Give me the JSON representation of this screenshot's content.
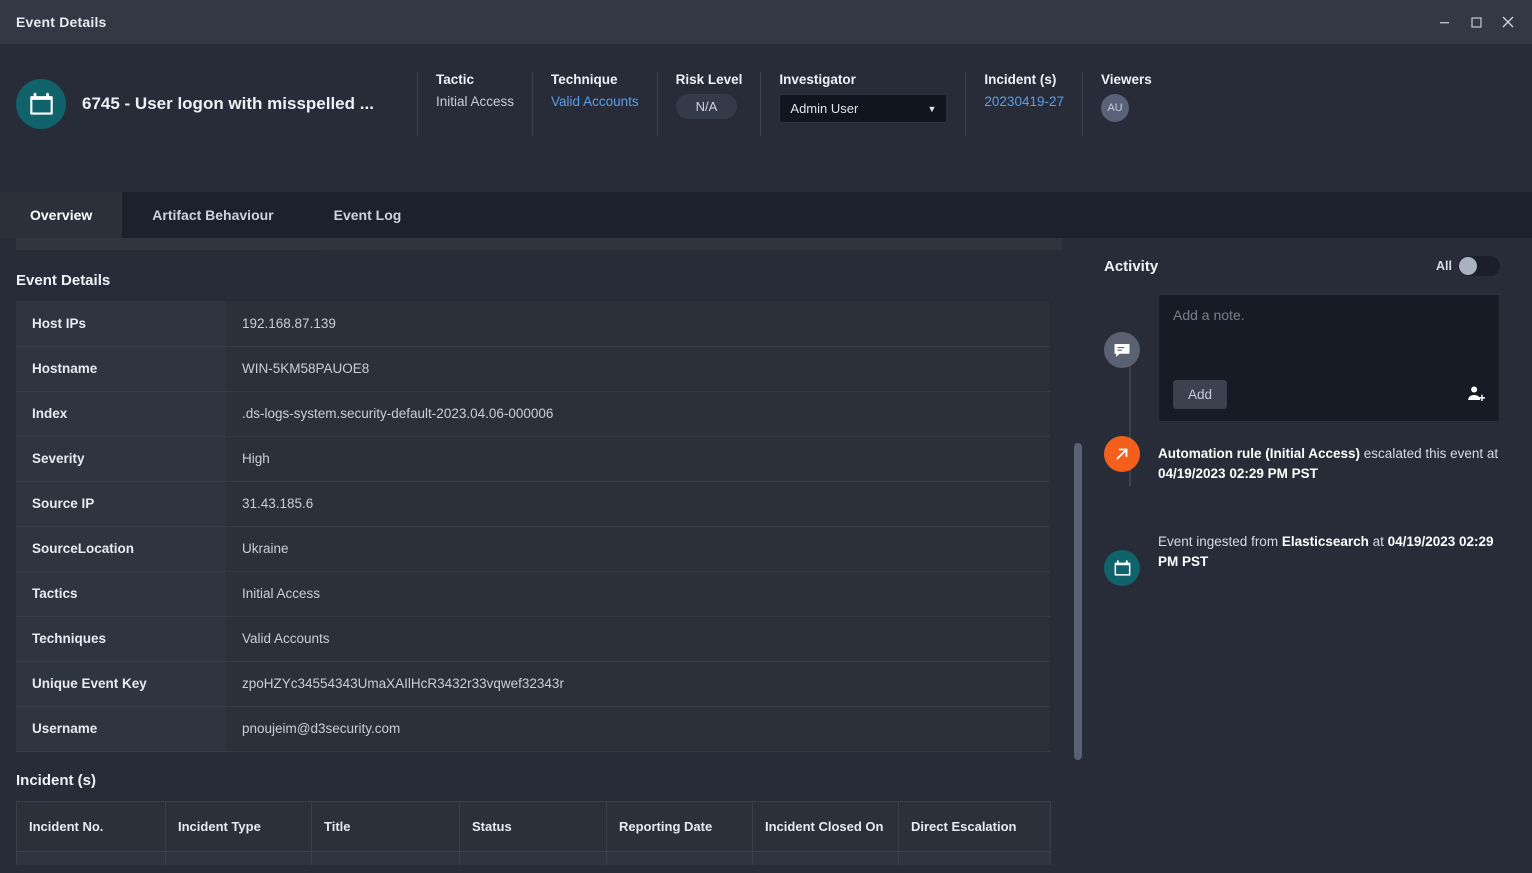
{
  "window": {
    "title": "Event Details",
    "controls": [
      {
        "name": "minimize",
        "glyph": "minimize-icon"
      },
      {
        "name": "maximize",
        "glyph": "maximize-icon"
      },
      {
        "name": "close",
        "glyph": "close-icon"
      }
    ]
  },
  "header": {
    "event_icon": "calendar-alert-icon",
    "event_title": "6745 - User logon with misspelled ...",
    "fields": [
      {
        "label": "Tactic",
        "value": "Initial Access"
      },
      {
        "label": "Technique",
        "value": "Valid Accounts"
      },
      {
        "label": "Risk Level",
        "value": "N/A"
      },
      {
        "label": "Investigator",
        "value": "Admin User"
      },
      {
        "label": "Incident (s)",
        "value": "20230419-27"
      },
      {
        "label": "Viewers",
        "value": "AU"
      }
    ],
    "tactic_label": "Tactic",
    "tactic_value": "Initial Access",
    "technique_label": "Technique",
    "technique_value": "Valid Accounts",
    "risk_label": "Risk Level",
    "risk_value": "N/A",
    "investigator_label": "Investigator",
    "investigator_value": "Admin User",
    "incident_label": "Incident (s)",
    "incident_value": "20230419-27",
    "viewers_label": "Viewers",
    "viewers_initials": "AU"
  },
  "tabs": [
    {
      "label": "Overview",
      "active": true
    },
    {
      "label": "Artifact Behaviour",
      "active": false
    },
    {
      "label": "Event Log",
      "active": false
    }
  ],
  "event_details": {
    "section_title": "Event Details",
    "rows": [
      {
        "key": "Host IPs",
        "value": "192.168.87.139"
      },
      {
        "key": "Hostname",
        "value": "WIN-5KM58PAUOE8"
      },
      {
        "key": "Index",
        "value": ".ds-logs-system.security-default-2023.04.06-000006"
      },
      {
        "key": "Severity",
        "value": "High"
      },
      {
        "key": "Source IP",
        "value": "31.43.185.6"
      },
      {
        "key": "SourceLocation",
        "value": "Ukraine"
      },
      {
        "key": "Tactics",
        "value": "Initial Access"
      },
      {
        "key": "Techniques",
        "value": "Valid Accounts"
      },
      {
        "key": "Unique Event Key",
        "value": "zpoHZYc34554343UmaXAIlHcR3432r33vqwef32343r"
      },
      {
        "key": "Username",
        "value": "pnoujeim@d3security.com"
      }
    ]
  },
  "incidents": {
    "section_title": "Incident (s)",
    "columns": [
      "Incident No.",
      "Incident Type",
      "Title",
      "Status",
      "Reporting Date",
      "Incident Closed On",
      "Direct Escalation"
    ]
  },
  "activity": {
    "title": "Activity",
    "toggle_label": "All",
    "note_placeholder": "Add a note.",
    "add_button": "Add",
    "add_user_icon": "add-user-icon",
    "entries": [
      {
        "icon": "comment-icon",
        "type": "note-composer"
      },
      {
        "icon": "escalate-arrow-icon",
        "bold_1": "Automation rule (Initial Access)",
        "mid": " escalated this event at ",
        "bold_2": "04/19/2023 02:29 PM PST"
      },
      {
        "icon": "calendar-alert-icon",
        "pre": "Event ingested from ",
        "bold_1": "Elasticsearch",
        "mid": " at ",
        "bold_2": "04/19/2023 02:29 PM PST"
      }
    ]
  },
  "colors": {
    "background": "#272c38",
    "titlebar": "#333845",
    "tabbar": "#1c212e",
    "accent_teal": "#10636b",
    "accent_orange": "#f4601c",
    "link_blue": "#5b9fe8",
    "row_key_bg": "#2e3440",
    "row_value_bg": "#2b303b"
  }
}
